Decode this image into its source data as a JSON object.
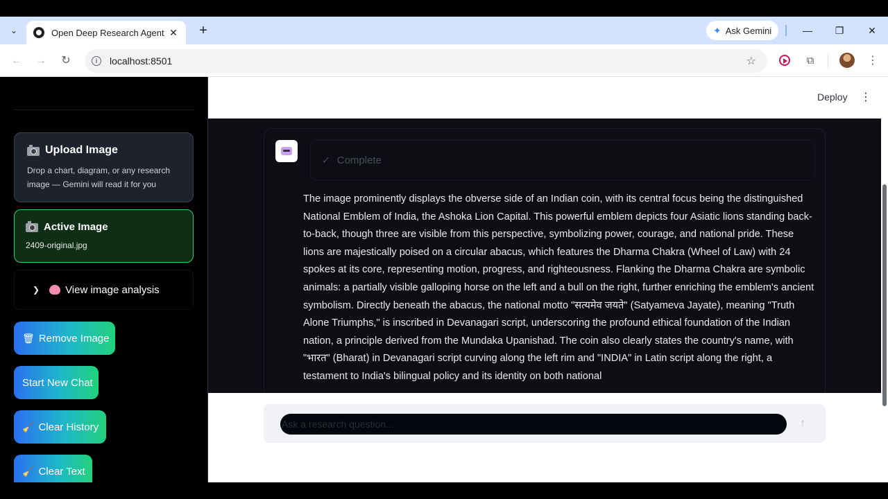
{
  "browser": {
    "tab_title": "Open Deep Research Agent",
    "tab_close": "✕",
    "new_tab": "+",
    "ask_gemini": "Ask Gemini",
    "url": "localhost:8501",
    "win_min": "—",
    "win_restore": "❐",
    "win_close": "✕"
  },
  "sidebar": {
    "upload_title": "Upload Image",
    "upload_desc": "Drop a chart, diagram, or any research image — Gemini will read it for you",
    "active_title": "Active Image",
    "active_file": "2409-original.jpg",
    "view_analysis": "View image analysis",
    "remove_image": "Remove Image",
    "start_new_chat": "Start New Chat",
    "clear_history": "Clear History",
    "clear_text": "Clear Text"
  },
  "header": {
    "deploy": "Deploy"
  },
  "message": {
    "status": "Complete",
    "text": "The image prominently displays the obverse side of an Indian coin, with its central focus being the distinguished National Emblem of India, the Ashoka Lion Capital. This powerful emblem depicts four Asiatic lions standing back-to-back, though three are visible from this perspective, symbolizing power, courage, and national pride. These lions are majestically poised on a circular abacus, which features the Dharma Chakra (Wheel of Law) with 24 spokes at its core, representing motion, progress, and righteousness. Flanking the Dharma Chakra are symbolic animals: a partially visible galloping horse on the left and a bull on the right, further enriching the emblem's ancient symbolism. Directly beneath the abacus, the national motto \"सत्यमेव जयते\" (Satyameva Jayate), meaning \"Truth Alone Triumphs,\" is inscribed in Devanagari script, underscoring the profound ethical foundation of the Indian nation, a principle derived from the Mundaka Upanishad. The coin also clearly states the country's name, with \"भारत\" (Bharat) in Devanagari script curving along the left rim and \"INDIA\" in Latin script along the right, a testament to India's bilingual policy and its identity on both national"
  },
  "chat": {
    "placeholder": "Ask a research question..."
  },
  "colors": {
    "accent_start": "#2b6ff0",
    "accent_end": "#21d27a",
    "active_border": "#2ecc71"
  }
}
